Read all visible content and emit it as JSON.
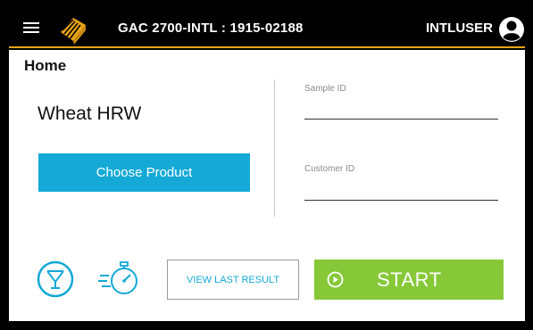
{
  "header": {
    "device_title": "GAC 2700-INTL : 1915-02188",
    "user_name": "INTLUSER"
  },
  "page": {
    "title": "Home"
  },
  "product": {
    "name": "Wheat HRW",
    "choose_label": "Choose Product"
  },
  "fields": {
    "sample_id": {
      "label": "Sample ID",
      "value": ""
    },
    "customer_id": {
      "label": "Customer ID",
      "value": ""
    }
  },
  "actions": {
    "filter_icon": "funnel-circle-icon",
    "timer_icon": "stopwatch-icon",
    "view_last_label": "VIEW LAST RESULT",
    "start_label": "START",
    "start_icon": "play-circle-icon"
  },
  "colors": {
    "header_bg": "#000000",
    "header_accent": "#e8a317",
    "primary_blue": "#14a9d6",
    "start_green": "#86c838"
  }
}
